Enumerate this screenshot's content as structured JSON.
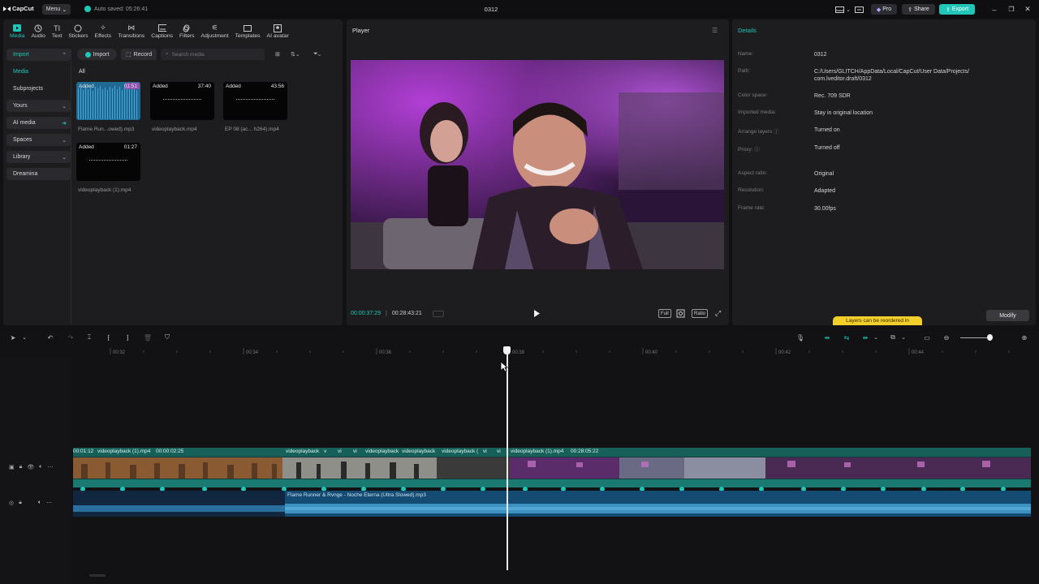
{
  "app": {
    "logo": "CapCut",
    "menu_label": "Menu",
    "autosave": "Auto saved: 05:26:41",
    "project_title": "0312",
    "pro_label": "Pro",
    "share_label": "Share",
    "export_label": "Export",
    "accent": "#1fc7b8"
  },
  "tabs": [
    {
      "label": "Media",
      "icon": "media-icon"
    },
    {
      "label": "Audio",
      "icon": "audio-icon"
    },
    {
      "label": "Text",
      "icon": "text-icon"
    },
    {
      "label": "Stickers",
      "icon": "stickers-icon"
    },
    {
      "label": "Effects",
      "icon": "effects-icon"
    },
    {
      "label": "Transitions",
      "icon": "transitions-icon"
    },
    {
      "label": "Captions",
      "icon": "captions-icon"
    },
    {
      "label": "Filters",
      "icon": "filters-icon"
    },
    {
      "label": "Adjustment",
      "icon": "adjustment-icon"
    },
    {
      "label": "Templates",
      "icon": "templates-icon"
    },
    {
      "label": "AI avatar",
      "icon": "ai-avatar-icon"
    }
  ],
  "sidenav": [
    {
      "label": "Import",
      "style": "box-sel"
    },
    {
      "label": "Media",
      "style": "sel"
    },
    {
      "label": "Subprojects",
      "style": "plain"
    },
    {
      "label": "Yours",
      "style": "box"
    },
    {
      "label": "AI media",
      "style": "box"
    },
    {
      "label": "Spaces",
      "style": "box"
    },
    {
      "label": "Library",
      "style": "box"
    },
    {
      "label": "Dreamina",
      "style": "box"
    }
  ],
  "media": {
    "import_label": "Import",
    "record_label": "Record",
    "search_placeholder": "Search media",
    "filter_all": "All",
    "items": [
      {
        "tag": "Added",
        "duration": "01:51",
        "name": "Flame Run...owed).mp3",
        "kind": "audio"
      },
      {
        "tag": "Added",
        "duration": "37:40",
        "name": "videoplayback.mp4",
        "kind": "video"
      },
      {
        "tag": "Added",
        "duration": "43:56",
        "name": "EP 08 (ac... h264).mp4",
        "kind": "video"
      },
      {
        "tag": "Added",
        "duration": "01:27",
        "name": "videoplayback (1).mp4",
        "kind": "video"
      }
    ]
  },
  "player": {
    "label": "Player",
    "current_time": "00:00:37:29",
    "total_time": "00:28:43:21",
    "full_label": "Full",
    "ratio_label": "Ratio"
  },
  "details": {
    "title": "Details",
    "rows": [
      {
        "key": "Name:",
        "value": "0312"
      },
      {
        "key": "Path:",
        "value": "C:/Users/GLITCH/AppData/Local/CapCut/User Data/Projects/ com.lveditor.draft/0312"
      },
      {
        "key": "Color space:",
        "value": "Rec. 709 SDR"
      },
      {
        "key": "Imported media:",
        "value": "Stay in original location"
      },
      {
        "key": "Arrange layers ⓘ",
        "value": "Turned on"
      },
      {
        "key": "Proxy: ⓘ",
        "value": "Turned off"
      },
      {
        "key": "Aspect ratio:",
        "value": "Original"
      },
      {
        "key": "Resolution:",
        "value": "Adapted"
      },
      {
        "key": "Frame rate:",
        "value": "30.00fps"
      }
    ],
    "warning": "Layers can be reordered in",
    "modify_label": "Modify"
  },
  "timeline": {
    "ruler": [
      "00:32",
      "00:34",
      "00:36",
      "00:38",
      "00:40",
      "00:42",
      "00:44"
    ],
    "video_clips": [
      "00:01:12",
      "videoplayback (1).mp4",
      "00:00:02:25",
      "videoplayback",
      "v",
      "vi",
      "vi",
      "videoplayback",
      "videoplayback",
      "videoplayback (",
      "vi",
      "vi",
      "videoplayback (1).mp4",
      "00:28:05:22"
    ],
    "audio_clip": "Flame Runner & Rvnge - Noche Eterna (Ultra Slowed).mp3"
  }
}
